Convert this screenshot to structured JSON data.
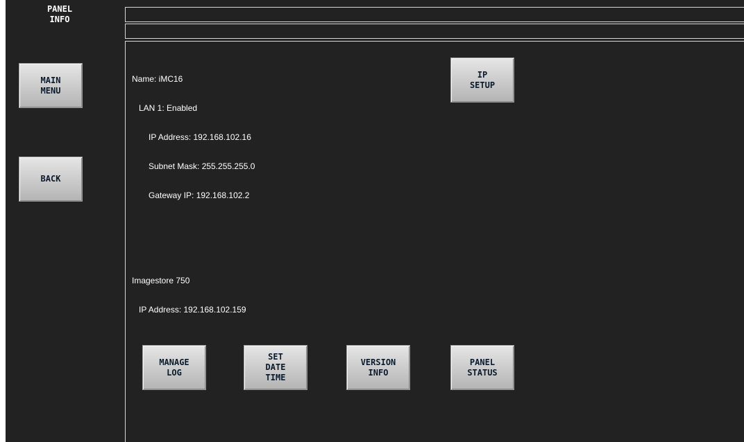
{
  "header": {
    "title_line1": "PANEL",
    "title_line2": "INFO"
  },
  "sidebar": {
    "main_menu_label": "MAIN\nMENU",
    "back_label": "BACK"
  },
  "panel": {
    "name": "Name: iMC16",
    "lan": "LAN 1: Enabled",
    "ip": "IP Address: 192.168.102.16",
    "subnet": "Subnet Mask: 255.255.255.0",
    "gateway": "Gateway IP: 192.168.102.2",
    "ip_setup_label": "IP\nSETUP"
  },
  "imagestore": {
    "name": "Imagestore 750",
    "ip": "IP Address: 192.168.102.159"
  },
  "actions": {
    "manage_log_label": "MANAGE\nLOG",
    "set_date_time_label": "SET\nDATE\nTIME",
    "version_info_label": "VERSION\nINFO",
    "panel_status_label": "PANEL\nSTATUS"
  },
  "colors": {
    "background": "#222222",
    "border": "#d8d8d8",
    "text": "#ffffff",
    "button_text": "#0a1a2c"
  }
}
